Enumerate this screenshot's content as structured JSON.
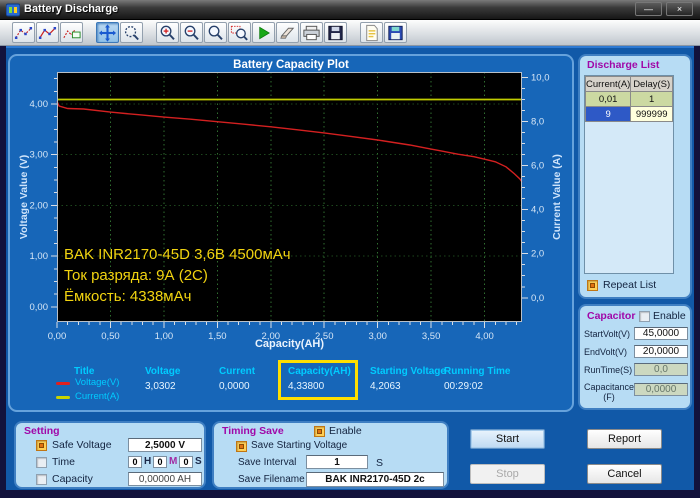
{
  "window": {
    "title": "Battery Discharge",
    "minimize_glyph": "—",
    "close_glyph": "×"
  },
  "toolbar": {
    "groups": [
      [
        "curve-points",
        "curve-line",
        "curve-area"
      ],
      [
        "pan-tool",
        "zoom-dynamic"
      ],
      [
        "zoom-in",
        "zoom-out",
        "zoom-reset",
        "zoom-window",
        "run",
        "erase",
        "print",
        "save-image"
      ],
      [
        "report-file",
        "save-data"
      ]
    ],
    "active": "pan-tool"
  },
  "chart": {
    "annotation_lines": [
      "BAK INR2170-45D 3,6В 4500мАч",
      "Ток разряда: 9А (2C)",
      "Ёмкость: 4338мАч"
    ]
  },
  "chart_data": {
    "type": "line",
    "title": "Battery Capacity Plot",
    "xlabel": "Capacity(AH)",
    "ylabel_left": "Voltage Value (V)",
    "ylabel_right": "Current Value (A)",
    "xlim": [
      0,
      4.35
    ],
    "ylim_left": [
      -0.3,
      4.63
    ],
    "ylim_right": [
      -1.1,
      10.25
    ],
    "x_tick_values": [
      0,
      0.5,
      1,
      1.5,
      2,
      2.5,
      3,
      3.5,
      4
    ],
    "x_tick_labels": [
      "0,00",
      "0,50",
      "1,00",
      "1,50",
      "2,00",
      "2,50",
      "3,00",
      "3,50",
      "4,00"
    ],
    "y_left_tick_values": [
      0,
      1,
      2,
      3,
      4
    ],
    "y_left_tick_labels": [
      "0,00",
      "1,00",
      "2,00",
      "3,00",
      "4,00"
    ],
    "y_right_tick_values": [
      0,
      2,
      4,
      6,
      8,
      10
    ],
    "y_right_tick_labels": [
      "0,0",
      "2,0",
      "4,0",
      "6,0",
      "8,0",
      "10,0"
    ],
    "grid": true,
    "plot_bg": "#000000",
    "series": [
      {
        "name": "Voltage(V)",
        "axis": "left",
        "color": "#d42020",
        "points": [
          [
            0,
            4.05
          ],
          [
            0.02,
            3.96
          ],
          [
            0.1,
            3.91
          ],
          [
            0.25,
            3.9
          ],
          [
            0.5,
            3.84
          ],
          [
            0.75,
            3.79
          ],
          [
            1.0,
            3.74
          ],
          [
            1.25,
            3.7
          ],
          [
            1.5,
            3.65
          ],
          [
            1.75,
            3.6
          ],
          [
            2.0,
            3.55
          ],
          [
            2.25,
            3.49
          ],
          [
            2.5,
            3.43
          ],
          [
            2.75,
            3.36
          ],
          [
            3.0,
            3.29
          ],
          [
            3.15,
            3.24
          ],
          [
            3.3,
            3.19
          ],
          [
            3.45,
            3.13
          ],
          [
            3.6,
            3.07
          ],
          [
            3.75,
            3.01
          ],
          [
            3.9,
            2.96
          ],
          [
            4.0,
            2.91
          ],
          [
            4.1,
            2.86
          ],
          [
            4.2,
            2.76
          ],
          [
            4.28,
            2.62
          ],
          [
            4.33,
            2.52
          ],
          [
            4.35,
            2.46
          ]
        ]
      },
      {
        "name": "Current(A)",
        "axis": "right",
        "color": "#c0cc00",
        "points": [
          [
            0,
            9
          ],
          [
            4.35,
            9
          ]
        ]
      }
    ]
  },
  "status": {
    "title_label": "Title",
    "legend": [
      {
        "name": "Voltage(V)",
        "color": "#e02020"
      },
      {
        "name": "Current(A)",
        "color": "#c8d400"
      }
    ],
    "columns": [
      {
        "label": "Voltage",
        "value": "3,0302"
      },
      {
        "label": "Current",
        "value": "0,0000"
      },
      {
        "label": "Capacity(AH)",
        "value": "4,33800"
      },
      {
        "label": "Starting Voltage",
        "value": "4,2063"
      },
      {
        "label": "Running Time",
        "value": "00:29:02"
      }
    ]
  },
  "discharge_list": {
    "title": "Discharge List",
    "headers": [
      "Current(A)",
      "Delay(S)"
    ],
    "rows": [
      [
        "0,01",
        "1"
      ],
      [
        "9",
        "999999"
      ]
    ],
    "selected_row": 1,
    "repeat_label": "Repeat List",
    "repeat_checked": true
  },
  "capacitor": {
    "title": "Capacitor",
    "enable_label": "Enable",
    "enable_checked": false,
    "fields": [
      {
        "label": "StartVolt(V)",
        "value": "45,0000",
        "enabled": true
      },
      {
        "label": "EndVolt(V)",
        "value": "20,0000",
        "enabled": true
      },
      {
        "label": "RunTime(S)",
        "value": "0,0",
        "enabled": false
      },
      {
        "label": "Capacitance (F)",
        "value": "0,0000",
        "enabled": false
      }
    ]
  },
  "setting": {
    "title": "Setting",
    "safe_voltage": {
      "label": "Safe Voltage",
      "checked": true,
      "value": "2,5000 V"
    },
    "time": {
      "label": "Time",
      "checked": false,
      "h": "0",
      "m": "0",
      "s": "0",
      "h_unit": "H",
      "m_unit": "M",
      "s_unit": "S"
    },
    "capacity": {
      "label": "Capacity",
      "checked": false,
      "value": "0,00000 AH"
    }
  },
  "timing_save": {
    "title": "Timing Save",
    "enable_label": "Enable",
    "enable_checked": true,
    "save_starting_label": "Save Starting Voltage",
    "save_starting_checked": true,
    "interval_label": "Save Interval",
    "interval_value": "1",
    "interval_unit": "S",
    "filename_label": "Save Filename",
    "filename_value": "BAK INR2170-45D 2c"
  },
  "actions": {
    "start": "Start",
    "stop": "Stop",
    "report": "Report",
    "cancel": "Cancel"
  },
  "colors": {
    "client_bg": "#1159A8",
    "panel_light": "#B7DCF4",
    "accent_cyan": "#00CCFF",
    "annotation_yellow": "#F2D410",
    "highlight_box": "#FFDF00",
    "title_purple": "#A008A8"
  }
}
